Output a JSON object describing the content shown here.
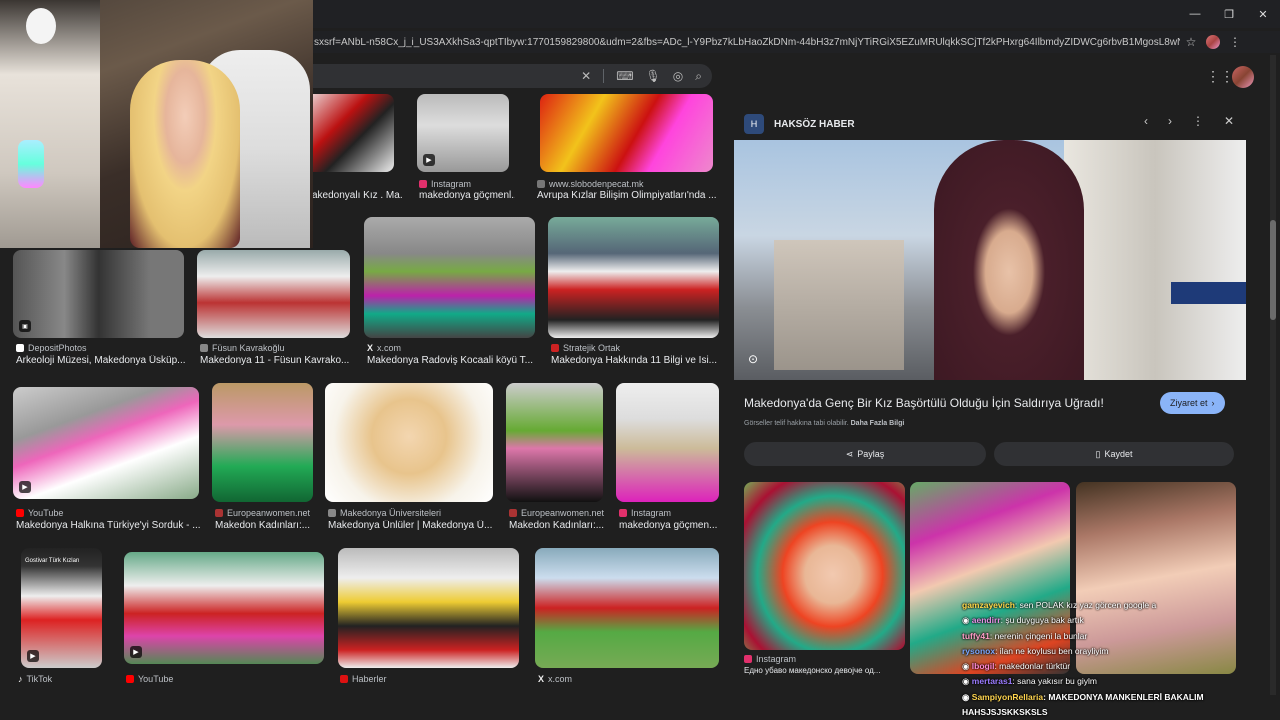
{
  "browser": {
    "url": "sxsrf=ANbL-n58Cx_j_i_US3AXkhSa3-qptTIbyw:1770159829800&udm=2&fbs=ADc_l-Y9Pbz7kLbHaoZkDNm-44bH3z7mNjYTiRGiX5EZuMRUlqkkSCjTf2kPHxrg64IlbmdyZIDWCg6rbvB1MgosL8wNMbF-6a8g_W6YVH...",
    "window_controls": [
      "—",
      "❐",
      "✕"
    ]
  },
  "results": [
    {
      "source": "",
      "title": "akedonyalı Kız . Ma...",
      "fav_color": "#c4302b"
    },
    {
      "source": "Instagram",
      "title": "makedonya göçmenl...",
      "fav_color": "#e1306c"
    },
    {
      "source": "www.slobodenpecat.mk",
      "title": "Avrupa Kızlar Bilişim Olimpiyatları'nda ...",
      "fav_color": "#777"
    },
    {
      "source": "DepositPhotos",
      "title": "Arkeoloji Müzesi, Makedonya Üsküp...",
      "fav_color": "#fff"
    },
    {
      "source": "Füsun Kavrakoğlu",
      "title": "Makedonya 11 - Füsun Kavrako...",
      "fav_color": "#888"
    },
    {
      "source": "x.com",
      "title": "Makedonya Radoviş Kocaali köyü T...",
      "fav_color": "#000"
    },
    {
      "source": "Stratejik Ortak",
      "title": "Makedonya Hakkında 11 Bilgi ve İsi...",
      "fav_color": "#c22"
    },
    {
      "source": "YouTube",
      "title": "Makedonya Halkına Türkiye'yi Sorduk - ...",
      "fav_color": "#f00"
    },
    {
      "source": "Europeanwomen.net",
      "title": "Makedon Kadınları:...",
      "fav_color": "#a33"
    },
    {
      "source": "Makedonya Üniversiteleri",
      "title": "Makedonya Ünlüler | Makedonya Ü...",
      "fav_color": "#888"
    },
    {
      "source": "Europeanwomen.net",
      "title": "Makedon Kadınları:...",
      "fav_color": "#a33"
    },
    {
      "source": "Instagram",
      "title": "makedonya göçmen...",
      "fav_color": "#e1306c"
    },
    {
      "source": "TikTok",
      "title": "",
      "fav_color": "#000"
    },
    {
      "source": "YouTube",
      "title": "",
      "fav_color": "#f00"
    },
    {
      "source": "Haberler",
      "title": "",
      "fav_color": "#d11"
    },
    {
      "source": "x.com",
      "title": "",
      "fav_color": "#000"
    }
  ],
  "thumb_text": {
    "tiktok_banner": "Gostivar Türk Kızları"
  },
  "panel": {
    "source_name": "HAKSÖZ HABER",
    "source_logo": "H",
    "hero_title": "Makedonya'da Genç Bir Kız Başörtülü Olduğu İçin Saldırıya Uğradı!",
    "visit_label": "Ziyaret et",
    "copyright": "Görseller telif hakkına tabi olabilir.",
    "learn_more": "Daha Fazla Bilgi",
    "share_label": "Paylaş",
    "save_label": "Kaydet",
    "related_source": "Instagram",
    "related_title": "Едно убаво македонско девојче од..."
  },
  "chat": [
    {
      "user": "gamzayevich",
      "msg": ": sen POLAK kız yaz görcen google a",
      "color": "#ffd94a"
    },
    {
      "user": "aendirr",
      "msg": ": şu duyguya bak artık",
      "color": "#e58fe5"
    },
    {
      "user": "tuffy41",
      "msg": ": nerenin çingeni la bunlar",
      "color": "#ff9ec8"
    },
    {
      "user": "rysonox",
      "msg": ": ilan ne koylusu ben orayliyim",
      "color": "#7aa7ff"
    },
    {
      "user": "lbogil",
      "msg": ": makedonlar türktür",
      "color": "#ff8ad4"
    },
    {
      "user": "mertaras1",
      "msg": ": sana yakısır bu giylm",
      "color": "#9b7bff"
    },
    {
      "user": "SampiyonRellaria",
      "msg": ": MAKEDONYA MANKENLERİ BAKALIM",
      "color": "#ffd54f"
    },
    {
      "user": "",
      "msg": "HAHSJSJSKKSKSLS",
      "color": "#fff"
    }
  ]
}
